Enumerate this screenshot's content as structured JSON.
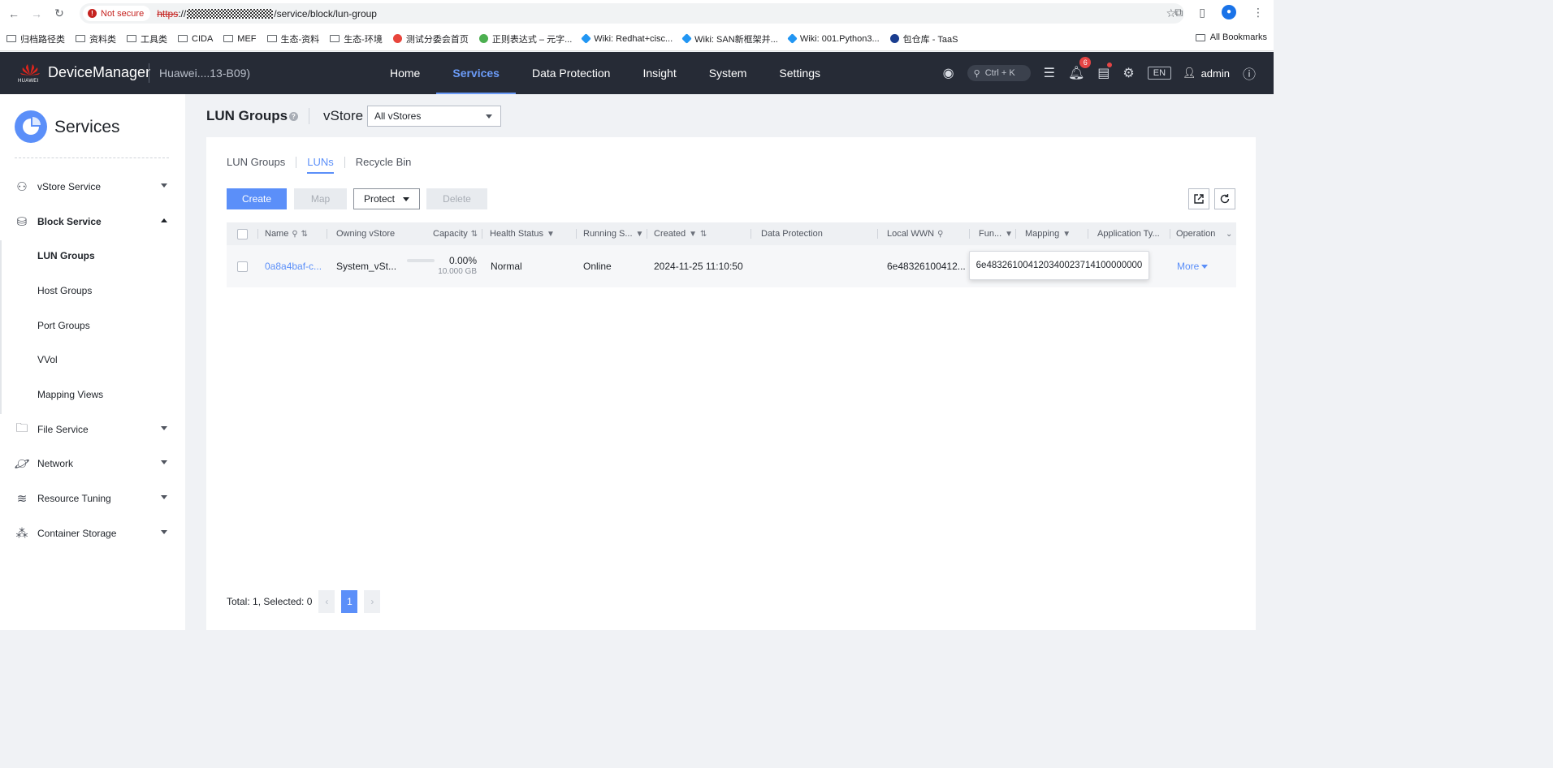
{
  "browser": {
    "not_secure": "Not secure",
    "url_scheme": "https",
    "url_sep": "://",
    "url_path": "/service/block/lun-group",
    "bookmarks": [
      "归档路径类",
      "资料类",
      "工具类",
      "CIDA",
      "MEF",
      "生态-资料",
      "生态-环境",
      "测试分委会首页",
      "正则表达式 – 元字...",
      "Wiki: Redhat+cisc...",
      "Wiki: SAN新框架并...",
      "Wiki: 001.Python3...",
      "包仓库 - TaaS"
    ],
    "all_bookmarks": "All Bookmarks"
  },
  "header": {
    "logo_text": "HUAWEI",
    "brand": "DeviceManager",
    "device": "Huawei....13-B09)",
    "nav": [
      "Home",
      "Services",
      "Data Protection",
      "Insight",
      "System",
      "Settings"
    ],
    "search_hint": "Ctrl + K",
    "notif_count": "6",
    "lang": "EN",
    "user": "admin"
  },
  "sidebar": {
    "title": "Services",
    "groups": {
      "vstore": "vStore Service",
      "block": "Block Service",
      "file": "File Service",
      "network": "Network",
      "tuning": "Resource Tuning",
      "container": "Container Storage"
    },
    "block_items": [
      "LUN Groups",
      "Host Groups",
      "Port Groups",
      "VVol",
      "Mapping Views"
    ]
  },
  "page": {
    "title": "LUN Groups",
    "vstore_label": "vStore",
    "vstore_value": "All vStores",
    "tabs": [
      "LUN Groups",
      "LUNs",
      "Recycle Bin"
    ],
    "buttons": {
      "create": "Create",
      "map": "Map",
      "protect": "Protect",
      "delete": "Delete"
    },
    "columns": [
      "Name",
      "Owning vStore",
      "Capacity",
      "Health Status",
      "Running S...",
      "Created",
      "Data Protection",
      "Local WWN",
      "Fun...",
      "Mapping",
      "Application Ty...",
      "Operation"
    ],
    "rows": [
      {
        "name": "0a8a4baf-c...",
        "vstore": "System_vSt...",
        "capacity_pct": "0.00%",
        "capacity_gb": "10.000 GB",
        "health": "Normal",
        "running": "Online",
        "created": "2024-11-25 11:10:50",
        "local_wwn": "6e48326100412...",
        "tooltip": "6e48326100412034002371410000000​0",
        "operation": "More"
      }
    ],
    "footer": {
      "total": "Total: 1, Selected: 0",
      "current_page": "1"
    }
  }
}
